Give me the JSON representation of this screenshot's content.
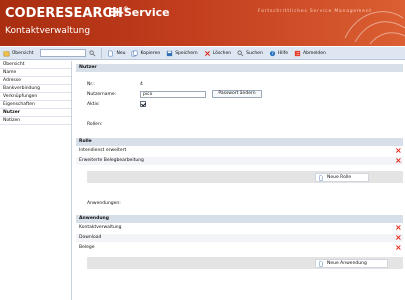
{
  "header": {
    "brand": "CODERESEARCH",
    "brand_mark": "®",
    "service": "El-Service",
    "subtitle": "Kontaktverwaltung",
    "tagline": "Fortschrittliches Service Management"
  },
  "toolbar": {
    "overview": "Übersicht",
    "search_value": "",
    "new": "Neu",
    "copy": "Kopieren",
    "save": "Speichern",
    "delete": "Löschen",
    "search": "Suchen",
    "help": "Hilfe",
    "logout": "Abmelden"
  },
  "sidebar": {
    "items": [
      {
        "label": "Übersicht"
      },
      {
        "label": "Name"
      },
      {
        "label": "Adresse"
      },
      {
        "label": "Bankverbindung"
      },
      {
        "label": "Verknüpfungen"
      },
      {
        "label": "Eigenschaften"
      },
      {
        "label": "Nutzer"
      },
      {
        "label": "Notizen"
      }
    ]
  },
  "main": {
    "section_title": "Nutzer",
    "nr_label": "Nr.:",
    "nr_value": "4",
    "username_label": "Nutzername:",
    "username_value": "pico",
    "password_button": "Passwort ändern",
    "active_label": "Aktiv:",
    "roles_label": "Rollen:",
    "roles_header": "Rolle",
    "roles": [
      {
        "label": "Intendienst erweitert"
      },
      {
        "label": "Erweiterte Belegbearbeitung"
      }
    ],
    "new_role": "Neue Rolle",
    "apps_label": "Anwendungen:",
    "apps_header": "Anwendung",
    "apps": [
      {
        "label": "Kontaktverwaltung"
      },
      {
        "label": "Download"
      },
      {
        "label": "Belege"
      }
    ],
    "new_app": "Neue Anwendung"
  }
}
